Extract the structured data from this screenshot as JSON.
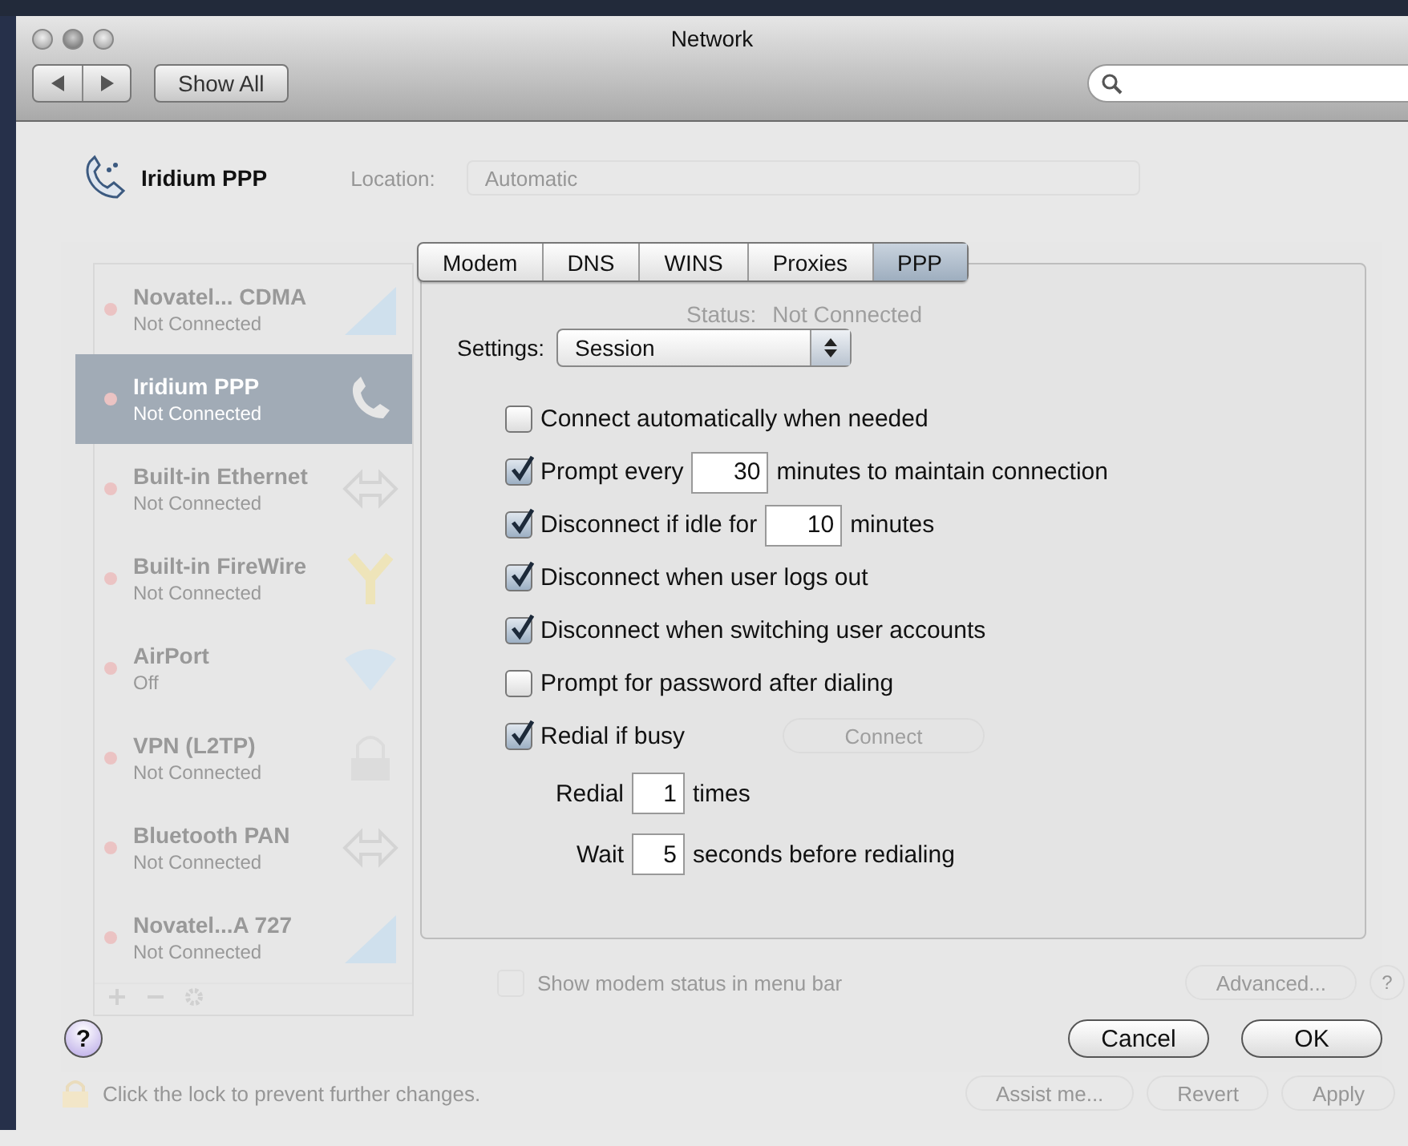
{
  "window": {
    "title": "Network"
  },
  "toolbar": {
    "show_all": "Show All"
  },
  "header": {
    "service_name": "Iridium PPP",
    "location_label": "Location:",
    "location_value": "Automatic"
  },
  "services": [
    {
      "name": "Novatel... CDMA",
      "status": "Not Connected",
      "kind": "cellular",
      "selected": false
    },
    {
      "name": "Iridium PPP",
      "status": "Not Connected",
      "kind": "phone",
      "selected": true
    },
    {
      "name": "Built-in Ethernet",
      "status": "Not Connected",
      "kind": "ethernet",
      "selected": false
    },
    {
      "name": "Built-in FireWire",
      "status": "Not Connected",
      "kind": "firewire",
      "selected": false
    },
    {
      "name": "AirPort",
      "status": "Off",
      "kind": "wifi",
      "selected": false
    },
    {
      "name": "VPN (L2TP)",
      "status": "Not Connected",
      "kind": "vpn",
      "selected": false
    },
    {
      "name": "Bluetooth PAN",
      "status": "Not Connected",
      "kind": "ethernet",
      "selected": false
    },
    {
      "name": "Novatel...A 727",
      "status": "Not Connected",
      "kind": "cellular",
      "selected": false
    }
  ],
  "detail": {
    "status_label": "Status:",
    "status_value": "Not Connected",
    "connect_button": "Connect",
    "show_modem_status": {
      "label": "Show modem status in menu bar",
      "checked": false
    },
    "advanced_button": "Advanced...",
    "help_button": "?"
  },
  "footer": {
    "lock_text": "Click the lock to prevent further changes.",
    "buttons": [
      "Assist me...",
      "Revert",
      "Apply"
    ]
  },
  "sheet": {
    "tabs": [
      {
        "label": "Modem",
        "selected": false
      },
      {
        "label": "DNS",
        "selected": false
      },
      {
        "label": "WINS",
        "selected": false
      },
      {
        "label": "Proxies",
        "selected": false
      },
      {
        "label": "PPP",
        "selected": true
      }
    ],
    "settings_label": "Settings:",
    "settings_value": "Session",
    "options": [
      {
        "kind": "checkbox",
        "checked": false,
        "label": "Connect automatically when needed"
      },
      {
        "kind": "checkbox",
        "checked": true,
        "label": "Prompt every",
        "value": "30",
        "after": "minutes to maintain connection"
      },
      {
        "kind": "checkbox",
        "checked": true,
        "label": "Disconnect if idle for",
        "value": "10",
        "after": "minutes"
      },
      {
        "kind": "checkbox",
        "checked": true,
        "label": "Disconnect when user logs out"
      },
      {
        "kind": "checkbox",
        "checked": true,
        "label": "Disconnect when switching user accounts"
      },
      {
        "kind": "checkbox",
        "checked": false,
        "label": "Prompt for password after dialing"
      },
      {
        "kind": "checkbox",
        "checked": true,
        "label": "Redial if busy"
      },
      {
        "kind": "field",
        "label": "Redial",
        "value": "1",
        "after": "times"
      },
      {
        "kind": "field",
        "label": "Wait",
        "value": "5",
        "after": "seconds before redialing"
      }
    ],
    "help_button": "?",
    "buttons": [
      "Cancel",
      "OK"
    ]
  }
}
